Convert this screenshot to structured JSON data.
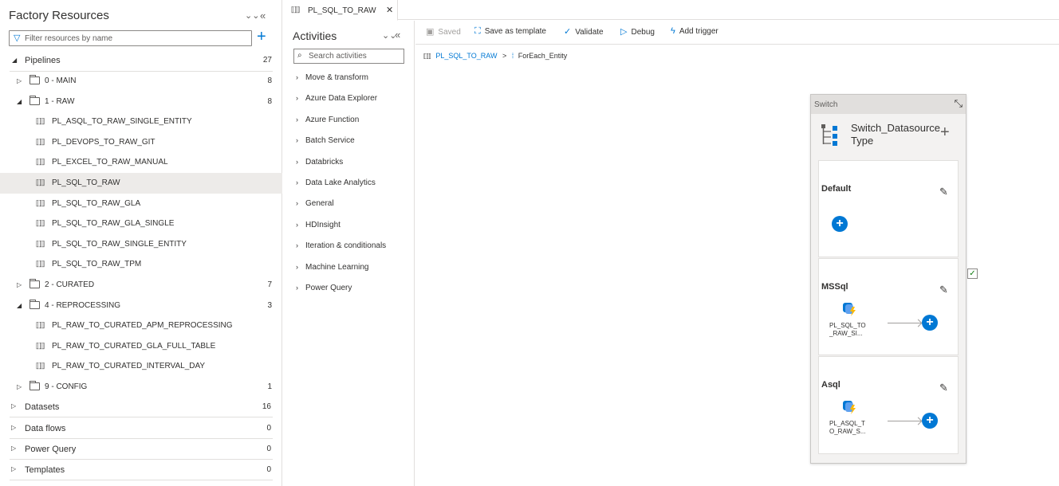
{
  "left_panel": {
    "title": "Factory Resources",
    "filter_placeholder": "Filter resources by name",
    "pipelines": {
      "label": "Pipelines",
      "count": "27"
    },
    "tree": [
      {
        "type": "folder",
        "label": "0 - MAIN",
        "count": "8",
        "expanded": false
      },
      {
        "type": "folder",
        "label": "1 - RAW",
        "count": "8",
        "expanded": true
      },
      {
        "type": "pipeline",
        "label": "PL_ASQL_TO_RAW_SINGLE_ENTITY"
      },
      {
        "type": "pipeline",
        "label": "PL_DEVOPS_TO_RAW_GIT"
      },
      {
        "type": "pipeline",
        "label": "PL_EXCEL_TO_RAW_MANUAL"
      },
      {
        "type": "pipeline",
        "label": "PL_SQL_TO_RAW",
        "selected": true
      },
      {
        "type": "pipeline",
        "label": "PL_SQL_TO_RAW_GLA"
      },
      {
        "type": "pipeline",
        "label": "PL_SQL_TO_RAW_GLA_SINGLE"
      },
      {
        "type": "pipeline",
        "label": "PL_SQL_TO_RAW_SINGLE_ENTITY"
      },
      {
        "type": "pipeline",
        "label": "PL_SQL_TO_RAW_TPM"
      },
      {
        "type": "folder",
        "label": "2 - CURATED",
        "count": "7",
        "expanded": false
      },
      {
        "type": "folder",
        "label": "4 - REPROCESSING",
        "count": "3",
        "expanded": true
      },
      {
        "type": "pipeline",
        "label": "PL_RAW_TO_CURATED_APM_REPROCESSING"
      },
      {
        "type": "pipeline",
        "label": "PL_RAW_TO_CURATED_GLA_FULL_TABLE"
      },
      {
        "type": "pipeline",
        "label": "PL_RAW_TO_CURATED_INTERVAL_DAY"
      },
      {
        "type": "folder",
        "label": "9 - CONFIG",
        "count": "1",
        "expanded": false
      }
    ],
    "sections": [
      {
        "label": "Datasets",
        "count": "16"
      },
      {
        "label": "Data flows",
        "count": "0"
      },
      {
        "label": "Power Query",
        "count": "0"
      },
      {
        "label": "Templates",
        "count": "0"
      }
    ]
  },
  "tab": {
    "label": "PL_SQL_TO_RAW",
    "close": "✕"
  },
  "activities": {
    "title": "Activities",
    "search_placeholder": "Search activities",
    "items": [
      "Move & transform",
      "Azure Data Explorer",
      "Azure Function",
      "Batch Service",
      "Databricks",
      "Data Lake Analytics",
      "General",
      "HDInsight",
      "Iteration & conditionals",
      "Machine Learning",
      "Power Query"
    ]
  },
  "toolbar": {
    "saved": "Saved",
    "save_template": "Save as template",
    "validate": "Validate",
    "debug": "Debug",
    "add_trigger": "Add trigger"
  },
  "breadcrumb": {
    "pipeline": "PL_SQL_TO_RAW",
    "separator": ">",
    "activity": "ForEach_Entity"
  },
  "switch": {
    "header": "Switch",
    "name_line1": "Switch_Datasource",
    "name_line2": "Type",
    "cases": [
      {
        "name": "Default"
      },
      {
        "name": "MSSql",
        "activity_line1": "PL_SQL_TO",
        "activity_line2": "_RAW_SI..."
      },
      {
        "name": "Asql",
        "activity_line1": "PL_ASQL_T",
        "activity_line2": "O_RAW_S..."
      }
    ]
  },
  "colors": {
    "accent": "#0078d4",
    "selected_row": "#edebe9",
    "check": "#107c10"
  }
}
